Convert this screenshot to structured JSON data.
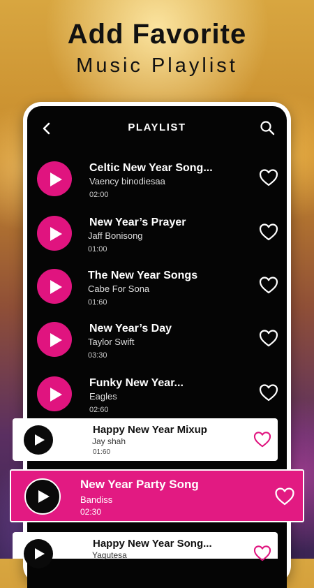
{
  "headline": {
    "line1": "Add Favorite",
    "line2": "Music Playlist"
  },
  "appbar": {
    "title": "PLAYLIST"
  },
  "songs": [
    {
      "title": "Celtic New Year Song...",
      "artist": "Vaency binodiesaa",
      "duration": "02:00"
    },
    {
      "title": "New Year’s Prayer",
      "artist": "Jaff Bonisong",
      "duration": "01:00"
    },
    {
      "title": "The New Year Songs",
      "artist": "Cabe For Sona",
      "duration": "01:60"
    },
    {
      "title": "New Year’s Day",
      "artist": "Taylor Swift",
      "duration": "03:30"
    },
    {
      "title": "Funky New Year...",
      "artist": "Eagles",
      "duration": "02:60"
    }
  ],
  "cards": [
    {
      "title": "Happy New Year Mixup",
      "artist": "Jay shah",
      "duration": "01:60"
    },
    {
      "title": "Happy New Year Song...",
      "artist": "Yagutesa",
      "duration": ""
    }
  ],
  "now_playing": {
    "title": "New Year Party Song",
    "artist": "Bandiss",
    "duration": "02:30"
  },
  "colors": {
    "accent": "#e0147f",
    "screen": "#050505",
    "text": "#ffffff"
  }
}
